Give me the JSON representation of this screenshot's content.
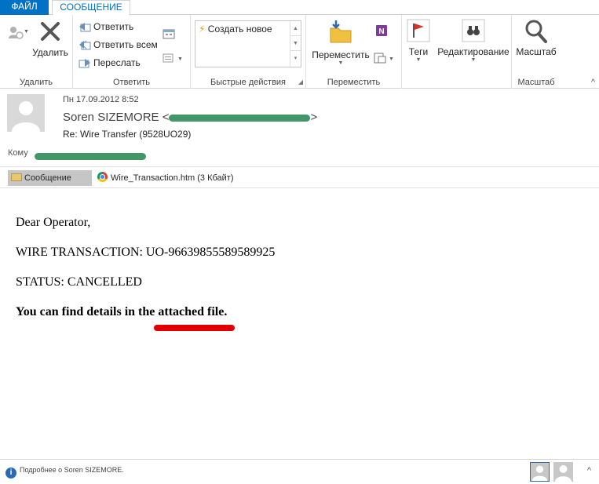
{
  "tabs": {
    "file": "ФАЙЛ",
    "message": "СООБЩЕНИЕ"
  },
  "ribbon": {
    "delete_group": {
      "label": "Удалить",
      "delete_button": "Удалить"
    },
    "respond_group": {
      "label": "Ответить",
      "reply": "Ответить",
      "reply_all": "Ответить всем",
      "forward": "Переслать"
    },
    "quick_steps": {
      "label": "Быстрые действия",
      "create_new": "Создать новое"
    },
    "move_group": {
      "label": "Переместить",
      "move_button": "Переместить"
    },
    "tags": {
      "label": "Теги"
    },
    "editing": {
      "label": "Редактирование"
    },
    "zoom_group": {
      "label": "Масштаб",
      "zoom_button": "Масштаб"
    }
  },
  "header": {
    "date": "Пн 17.09.2012 8:52",
    "sender_name": "Soren SIZEMORE <",
    "sender_close": ">",
    "subject": "Re: Wire Transfer (9528UO29)",
    "to_label": "Кому"
  },
  "attachments": {
    "message_tab": "Сообщение",
    "file": "Wire_Transaction.htm (3 Кбайт)"
  },
  "body": {
    "greeting": "Dear Operator,",
    "transaction": "WIRE TRANSACTION: UO-96639855589589925",
    "status": "STATUS: CANCELLED",
    "details": "You can find details in the attached file."
  },
  "people_pane": {
    "info": "Подробнее о Soren SIZEMORE."
  },
  "colors": {
    "accent": "#0072c6",
    "redaction": "#2e8b57",
    "highlight": "#e00000"
  }
}
